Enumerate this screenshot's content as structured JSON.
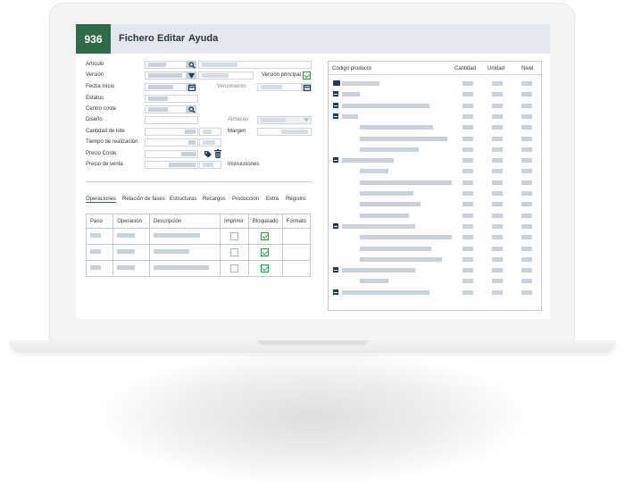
{
  "app": {
    "number": "936"
  },
  "menu": {
    "items": [
      "Fichero",
      "Editar",
      "Ayuda"
    ]
  },
  "form": {
    "labels": {
      "articulo": "Artículo",
      "version": "Versión",
      "fecha_inicio": "Fecha inicio",
      "estatus": "Estatus",
      "centro_coste": "Centro coste",
      "diseno": "Diseño",
      "cantidad_lote": "Cantidad de lote",
      "tiempo_realizacion": "Tiempo de realización",
      "precio_coste": "Precio Coste",
      "precio_venta": "Precio de venta",
      "version_principal": "Versión principal",
      "vencimiento": "Vencimiento",
      "almacen": "Almacén",
      "margen": "Margen",
      "instrucciones": "Instrucciones"
    }
  },
  "tabs": [
    "Operaciones",
    "Relación de fases",
    "Estructuras",
    "Recargos",
    "Producción",
    "Extra",
    "Registro"
  ],
  "operations_table": {
    "headers": [
      "Paso",
      "Operación",
      "Descripción",
      "Imprimir",
      "Bloqueado",
      "Formato"
    ],
    "rows": [
      {
        "imprimir": false,
        "bloqueado": true
      },
      {
        "imprimir": false,
        "bloqueado": true
      },
      {
        "imprimir": false,
        "bloqueado": true
      }
    ]
  },
  "tree": {
    "headers": [
      "Código producto",
      "Cantidad",
      "Unidad",
      "Nivel"
    ]
  },
  "colors": {
    "brand": "#2e6b47",
    "header_bg": "#e4e8ee",
    "check": "#2e9e3c",
    "placeholder": "#c7d0db"
  }
}
